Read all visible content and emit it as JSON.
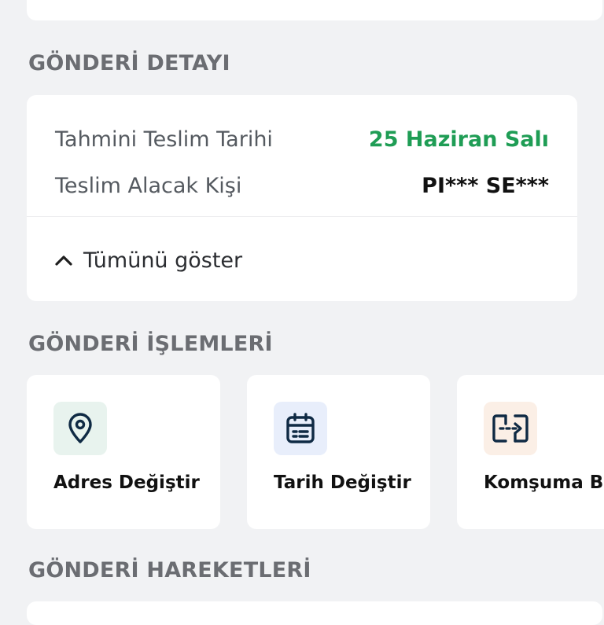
{
  "sections": {
    "detail_title": "GÖNDERİ DETAYI",
    "actions_title": "GÖNDERİ İŞLEMLERİ",
    "movements_title": "GÖNDERİ HAREKETLERİ"
  },
  "detail": {
    "rows": [
      {
        "label": "Tahmini Teslim Tarihi",
        "value": "25 Haziran Salı"
      },
      {
        "label": "Teslim Alacak Kişi",
        "value": "PI*** SE***"
      }
    ],
    "toggle_label": "Tümünü göster",
    "toggle_icon": "chevron-up-icon"
  },
  "actions": [
    {
      "label": "Adres Değiştir",
      "icon": "location-pin-icon",
      "icon_bg": "#e8f3ee"
    },
    {
      "label": "Tarih Değiştir",
      "icon": "calendar-icon",
      "icon_bg": "#e8eefb"
    },
    {
      "label": "Komşuma Bı",
      "icon": "transfer-box-icon",
      "icon_bg": "#fbefe6"
    }
  ],
  "colors": {
    "accent_green": "#1f9d55",
    "icon_navy": "#0f2a44",
    "background": "#f1f2f4"
  }
}
